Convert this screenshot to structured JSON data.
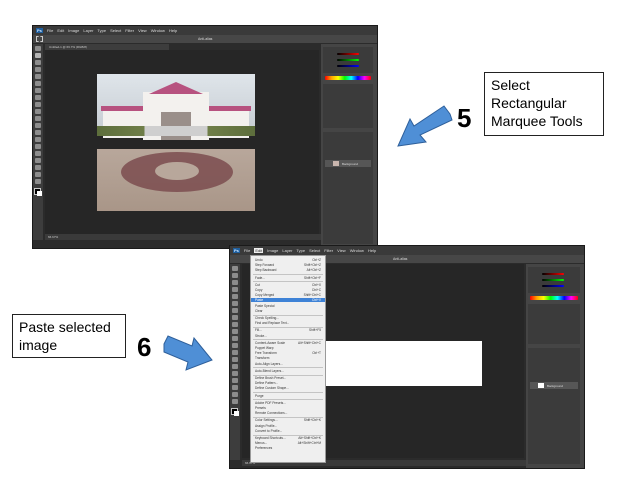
{
  "step5": {
    "number": "5",
    "label_lines": [
      "Select",
      "Rectangular",
      "Marquee Tools"
    ]
  },
  "step6": {
    "number": "6",
    "label_lines": [
      "Paste selected",
      "image"
    ]
  },
  "screenshot1": {
    "menu_items": [
      "Ps",
      "File",
      "Edit",
      "Image",
      "Layer",
      "Type",
      "Select",
      "Filter",
      "View",
      "Window",
      "Help"
    ],
    "options_text": "Anti-alias",
    "doc_tab": "Untitled-1 @ 66.7% (RGB/8)",
    "status_text": "66.67%",
    "layer_name": "Background"
  },
  "screenshot2": {
    "menu_items": [
      "Ps",
      "File",
      "Edit",
      "Image",
      "Layer",
      "Type",
      "Select",
      "Filter",
      "View",
      "Window",
      "Help"
    ],
    "options_text": "Anti-alias",
    "status_text": "66.67%",
    "layer_name": "Background",
    "edit_menu": [
      {
        "label": "Undo",
        "shortcut": "Ctrl+Z"
      },
      {
        "label": "Step Forward",
        "shortcut": "Shift+Ctrl+Z"
      },
      {
        "label": "Step Backward",
        "shortcut": "Alt+Ctrl+Z"
      },
      {
        "label": "Fade...",
        "shortcut": "Shift+Ctrl+F"
      },
      {
        "label": "Cut",
        "shortcut": "Ctrl+X"
      },
      {
        "label": "Copy",
        "shortcut": "Ctrl+C"
      },
      {
        "label": "Copy Merged",
        "shortcut": "Shift+Ctrl+C"
      },
      {
        "label": "Paste",
        "shortcut": "Ctrl+V"
      },
      {
        "label": "Paste Special",
        "shortcut": ""
      },
      {
        "label": "Clear",
        "shortcut": ""
      },
      {
        "label": "Check Spelling...",
        "shortcut": ""
      },
      {
        "label": "Find and Replace Text...",
        "shortcut": ""
      },
      {
        "label": "Fill...",
        "shortcut": "Shift+F5"
      },
      {
        "label": "Stroke...",
        "shortcut": ""
      },
      {
        "label": "Content-Aware Scale",
        "shortcut": "Alt+Shift+Ctrl+C"
      },
      {
        "label": "Puppet Warp",
        "shortcut": ""
      },
      {
        "label": "Free Transform",
        "shortcut": "Ctrl+T"
      },
      {
        "label": "Transform",
        "shortcut": ""
      },
      {
        "label": "Auto-Align Layers...",
        "shortcut": ""
      },
      {
        "label": "Auto-Blend Layers...",
        "shortcut": ""
      },
      {
        "label": "Define Brush Preset...",
        "shortcut": ""
      },
      {
        "label": "Define Pattern...",
        "shortcut": ""
      },
      {
        "label": "Define Custom Shape...",
        "shortcut": ""
      },
      {
        "label": "Purge",
        "shortcut": ""
      },
      {
        "label": "Adobe PDF Presets...",
        "shortcut": ""
      },
      {
        "label": "Presets",
        "shortcut": ""
      },
      {
        "label": "Remote Connections...",
        "shortcut": ""
      },
      {
        "label": "Color Settings...",
        "shortcut": "Shift+Ctrl+K"
      },
      {
        "label": "Assign Profile...",
        "shortcut": ""
      },
      {
        "label": "Convert to Profile...",
        "shortcut": ""
      },
      {
        "label": "Keyboard Shortcuts...",
        "shortcut": "Alt+Shift+Ctrl+K"
      },
      {
        "label": "Menus...",
        "shortcut": "Alt+Shift+Ctrl+M"
      },
      {
        "label": "Preferences",
        "shortcut": ""
      }
    ]
  },
  "colors": {
    "ps_bg": "#2b2b2b",
    "highlight": "#3e82d6",
    "arrow_fill": "#4f8fd6",
    "arrow_stroke": "#2e5f9a"
  }
}
